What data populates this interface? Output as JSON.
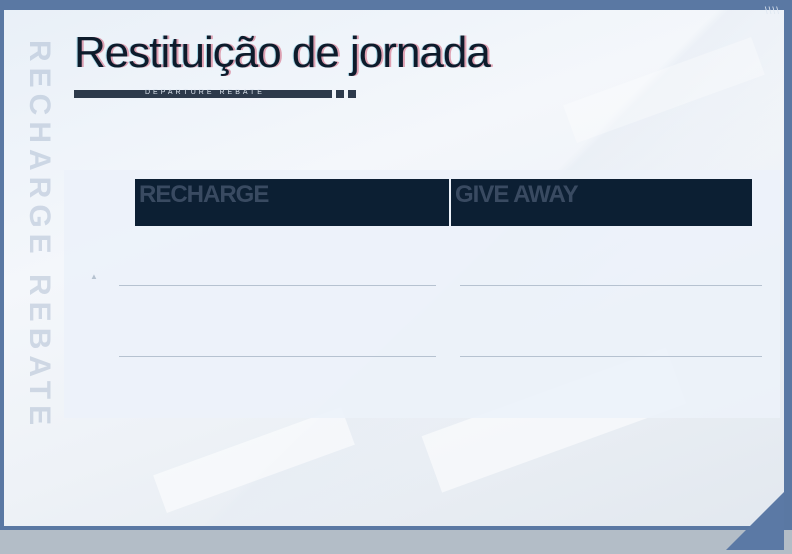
{
  "title": "Restituição de jornada",
  "subtitle": "DEPARTURE REBATE",
  "watermark": "RECHARGE REBATE",
  "corner_marks": "\\\\\\\\",
  "table": {
    "columns": [
      "RECHARGE",
      "GIVE AWAY"
    ],
    "row_marker": "▲"
  },
  "colors": {
    "frame": "#5a78a3",
    "header_bg": "#0c1f33",
    "title_text": "#0d1b2b"
  }
}
